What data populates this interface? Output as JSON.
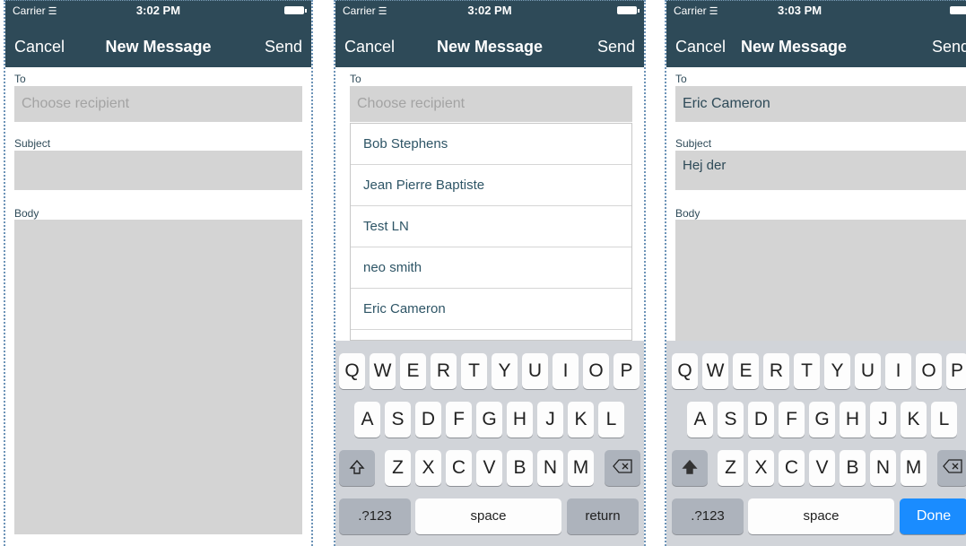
{
  "screens": [
    {
      "status": {
        "carrier": "Carrier",
        "time": "3:02 PM"
      },
      "nav": {
        "cancel": "Cancel",
        "title": "New Message",
        "send": "Send"
      },
      "to_label": "To",
      "to_placeholder": "Choose recipient",
      "subject_label": "Subject",
      "body_label": "Body"
    },
    {
      "status": {
        "carrier": "Carrier",
        "time": "3:02 PM"
      },
      "nav": {
        "cancel": "Cancel",
        "title": "New Message",
        "send": "Send"
      },
      "to_label": "To",
      "to_placeholder": "Choose recipient",
      "recipients": [
        "Bob Stephens",
        "Jean Pierre Baptiste",
        "Test LN",
        "neo smith",
        "Eric Cameron"
      ],
      "keyboard": {
        "row1": [
          "Q",
          "W",
          "E",
          "R",
          "T",
          "Y",
          "U",
          "I",
          "O",
          "P"
        ],
        "row2": [
          "A",
          "S",
          "D",
          "F",
          "G",
          "H",
          "J",
          "K",
          "L"
        ],
        "row3": [
          "Z",
          "X",
          "C",
          "V",
          "B",
          "N",
          "M"
        ],
        "numbers_key": ".?123",
        "space_key": "space",
        "action_key": "return"
      }
    },
    {
      "status": {
        "carrier": "Carrier",
        "time": "3:03 PM"
      },
      "nav": {
        "cancel": "Cancel",
        "title": "New Message",
        "send": "Send"
      },
      "to_label": "To",
      "to_value": "Eric Cameron",
      "subject_label": "Subject",
      "subject_value": "Hej der",
      "body_label": "Body",
      "keyboard": {
        "row1": [
          "Q",
          "W",
          "E",
          "R",
          "T",
          "Y",
          "U",
          "I",
          "O",
          "P"
        ],
        "row2": [
          "A",
          "S",
          "D",
          "F",
          "G",
          "H",
          "J",
          "K",
          "L"
        ],
        "row3": [
          "Z",
          "X",
          "C",
          "V",
          "B",
          "N",
          "M"
        ],
        "numbers_key": ".?123",
        "space_key": "space",
        "action_key": "Done"
      }
    }
  ],
  "colors": {
    "navbar": "#2e4a58",
    "field_bg": "#d4d4d4",
    "keyboard_bg": "#d1d4d9",
    "done_key": "#1a8cff"
  },
  "icons": [
    "wifi-icon",
    "battery-icon",
    "shift-icon",
    "delete-icon"
  ]
}
